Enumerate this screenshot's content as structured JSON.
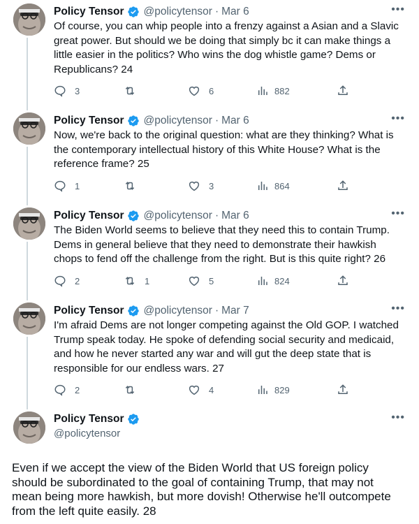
{
  "author": {
    "name": "Policy Tensor",
    "handle": "@policytensor"
  },
  "separator": "·",
  "tweets": [
    {
      "date": "Mar 6",
      "text": "Of course, you can whip people into a frenzy against a Asian and a Slavic great power. But should we be doing that simply bc it can make things a little easier in the politics? Who wins the dog whistle game? Dems or Republicans? 24",
      "replies": "3",
      "retweets": "",
      "likes": "6",
      "views": "882"
    },
    {
      "date": "Mar 6",
      "text": "Now, we're back to the original question: what are they thinking? What is the contemporary intellectual history of this White House? What is the reference frame? 25",
      "replies": "1",
      "retweets": "",
      "likes": "3",
      "views": "864"
    },
    {
      "date": "Mar 6",
      "text": "The Biden World seems to believe that they need this to contain Trump. Dems in general believe that they need to demonstrate their hawkish chops to fend off the challenge from the right. But is this quite right? 26",
      "replies": "2",
      "retweets": "1",
      "likes": "5",
      "views": "824"
    },
    {
      "date": "Mar 7",
      "text": "I'm afraid Dems are not longer competing against the Old GOP. I watched Trump speak today. He spoke of defending social security and medicaid, and how he never started any war and will gut the deep state that is responsible for our endless wars. 27",
      "replies": "2",
      "retweets": "",
      "likes": "4",
      "views": "829"
    }
  ],
  "main_tweet": {
    "text": "Even if we accept the view of the Biden World that US foreign policy should be subordinated to the goal of containing Trump, that may not mean being more hawkish, but more dovish! Otherwise he'll outcompete from the left quite easily.  28"
  },
  "icons": {
    "verified": "verified-badge-icon",
    "more": "more-options-icon",
    "reply": "reply-icon",
    "retweet": "retweet-icon",
    "like": "like-icon",
    "views": "views-icon",
    "share": "share-icon"
  },
  "colors": {
    "text": "#0f1419",
    "secondary": "#536471",
    "verified": "#1d9bf0",
    "thread_line": "#cfd9de"
  }
}
